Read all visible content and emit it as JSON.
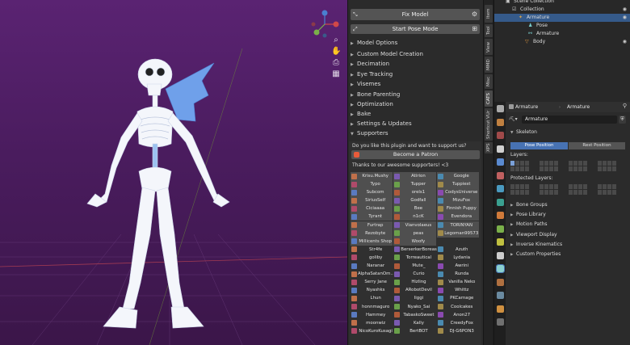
{
  "viewport": {
    "background_top": "#5a2372",
    "background_bottom": "#3b1649"
  },
  "panel": {
    "fix_model_label": "Fix Model",
    "start_pose_mode_label": "Start Pose Mode",
    "sections": [
      "Model Options",
      "Custom Model Creation",
      "Decimation",
      "Eye Tracking",
      "Visemes",
      "Bone Parenting",
      "Optimization",
      "Bake",
      "Settings & Updates",
      "Supporters"
    ],
    "support_question": "Do you like this plugin and want to support us?",
    "become_patron_label": "Become a Patron",
    "thanks_text": "Thanks to our awesome supporters! <3",
    "supporters": [
      [
        "Krisu.Mushy",
        "Atirion",
        "Google"
      ],
      [
        "Typo",
        "Tupper",
        "Tuppiest"
      ],
      [
        "Subcom",
        "orels1",
        "CodysUniverse"
      ],
      [
        "SiriusSelf",
        "Godfall",
        "MizuFox"
      ],
      [
        "Ciciaaaa",
        "Bee",
        "Finnish Puppy"
      ],
      [
        "Tyrant",
        "n1cK",
        "Evendora"
      ],
      [
        "Furtrap",
        "Vianvolaeus",
        "TORINYAN"
      ],
      [
        "Rezobyte",
        "peas",
        "Legoman99573"
      ],
      [
        "Millicents Shop",
        "Woofy",
        ""
      ],
      [
        "Str4fe",
        "BerserkerBoreas",
        "Azuth"
      ],
      [
        "goliby",
        "Torreautical",
        "Lydania"
      ],
      [
        "Naranar",
        "Mute_",
        "Awrini"
      ],
      [
        "AlphaSatanOm...",
        "Curio",
        "Runda"
      ],
      [
        "Serry Jane",
        "Hizling",
        "Vanilla Neko"
      ],
      [
        "Nyashks",
        "ARobotDevil",
        "Whittz"
      ],
      [
        "Lhun",
        "Iiggi",
        "PKCarnage"
      ],
      [
        "honnmaguro",
        "Nyako_Sai",
        "Coolcakes"
      ],
      [
        "Hammey",
        "TabaskoSweet",
        "Anon27"
      ],
      [
        "moonwiz",
        "Kally",
        "CreedyFox"
      ],
      [
        "NicoKuroKusagi",
        "BertBOT",
        "DJ-G6PON3"
      ]
    ]
  },
  "tabs": [
    "Item",
    "Tool",
    "View",
    "MMD",
    "Misc",
    "CATS",
    "Shortcut VUr",
    "XPS"
  ],
  "outliner": {
    "rows": [
      {
        "label": "Scene Collection",
        "indent": 24
      },
      {
        "label": "Collection",
        "indent": 32
      },
      {
        "label": "Armature",
        "indent": 40
      },
      {
        "label": "Pose",
        "indent": 52
      },
      {
        "label": "Armature",
        "indent": 52
      },
      {
        "label": "Body",
        "indent": 48
      }
    ]
  },
  "properties": {
    "object_name": "Armature",
    "data_name": "Armature",
    "armature_field": "Armature",
    "skeleton_label": "Skeleton",
    "pose_position_label": "Pose Position",
    "rest_position_label": "Rest Position",
    "layers_label": "Layers:",
    "protected_layers_label": "Protected Layers:",
    "sections": [
      "Bone Groups",
      "Pose Library",
      "Motion Paths",
      "Viewport Display",
      "Inverse Kinematics",
      "Custom Properties"
    ]
  },
  "colors": {
    "accent_blue": "#4772b3",
    "selected_row": "#355a8a",
    "patron_orange": "#e85b3a"
  }
}
